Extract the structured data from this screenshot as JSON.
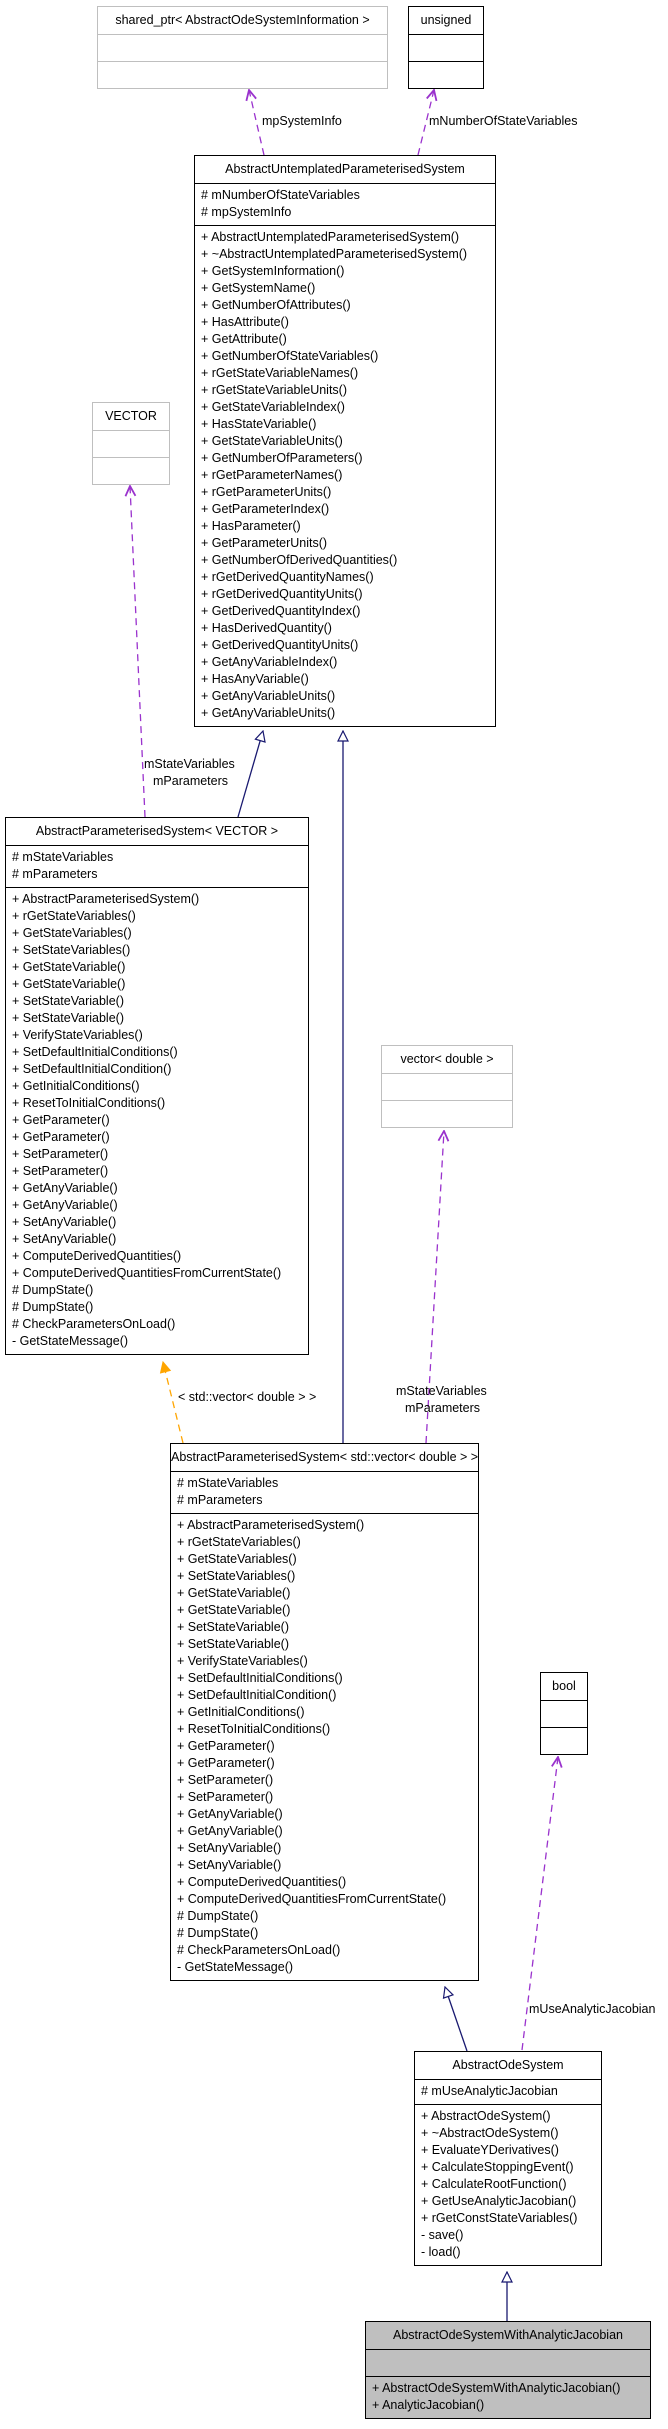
{
  "colors": {
    "inheritance": "#191970",
    "usage": "#9a32cd",
    "template": "#ffa500",
    "focus_fill": "#bfbfbf",
    "external_border": "#bfbfbf"
  },
  "classes": {
    "shared_ptr": {
      "name": "shared_ptr< AbstractOdeSystemInformation >",
      "attributes": [],
      "methods": []
    },
    "unsigned": {
      "name": "unsigned",
      "attributes": [],
      "methods": []
    },
    "vector_tpl": {
      "name": "VECTOR",
      "attributes": [],
      "methods": []
    },
    "vector_double": {
      "name": "vector< double >",
      "attributes": [],
      "methods": []
    },
    "bool": {
      "name": "bool",
      "attributes": [],
      "methods": []
    },
    "aups": {
      "name": "AbstractUntemplatedParameterisedSystem",
      "attributes": [
        "# mNumberOfStateVariables",
        "# mpSystemInfo"
      ],
      "methods": [
        "+ AbstractUntemplatedParameterisedSystem()",
        "+ ~AbstractUntemplatedParameterisedSystem()",
        "+ GetSystemInformation()",
        "+ GetSystemName()",
        "+ GetNumberOfAttributes()",
        "+ HasAttribute()",
        "+ GetAttribute()",
        "+ GetNumberOfStateVariables()",
        "+ rGetStateVariableNames()",
        "+ rGetStateVariableUnits()",
        "+ GetStateVariableIndex()",
        "+ HasStateVariable()",
        "+ GetStateVariableUnits()",
        "+ GetNumberOfParameters()",
        "+ rGetParameterNames()",
        "+ rGetParameterUnits()",
        "+ GetParameterIndex()",
        "+ HasParameter()",
        "+ GetParameterUnits()",
        "+ GetNumberOfDerivedQuantities()",
        "+ rGetDerivedQuantityNames()",
        "+ rGetDerivedQuantityUnits()",
        "+ GetDerivedQuantityIndex()",
        "+ HasDerivedQuantity()",
        "+ GetDerivedQuantityUnits()",
        "+ GetAnyVariableIndex()",
        "+ HasAnyVariable()",
        "+ GetAnyVariableUnits()",
        "+ GetAnyVariableUnits()"
      ]
    },
    "aps_vector": {
      "name": "AbstractParameterisedSystem< VECTOR >",
      "attributes": [
        "# mStateVariables",
        "# mParameters"
      ],
      "methods": [
        "+ AbstractParameterisedSystem()",
        "+ rGetStateVariables()",
        "+ GetStateVariables()",
        "+ SetStateVariables()",
        "+ GetStateVariable()",
        "+ GetStateVariable()",
        "+ SetStateVariable()",
        "+ SetStateVariable()",
        "+ VerifyStateVariables()",
        "+ SetDefaultInitialConditions()",
        "+ SetDefaultInitialCondition()",
        "+ GetInitialConditions()",
        "+ ResetToInitialConditions()",
        "+ GetParameter()",
        "+ GetParameter()",
        "+ SetParameter()",
        "+ SetParameter()",
        "+ GetAnyVariable()",
        "+ GetAnyVariable()",
        "+ SetAnyVariable()",
        "+ SetAnyVariable()",
        "+ ComputeDerivedQuantities()",
        "+ ComputeDerivedQuantitiesFromCurrentState()",
        "# DumpState()",
        "# DumpState()",
        "# CheckParametersOnLoad()",
        "- GetStateMessage()"
      ]
    },
    "aps_stdvector": {
      "name": "AbstractParameterisedSystem< std::vector< double > >",
      "attributes": [
        "# mStateVariables",
        "# mParameters"
      ],
      "methods": [
        "+ AbstractParameterisedSystem()",
        "+ rGetStateVariables()",
        "+ GetStateVariables()",
        "+ SetStateVariables()",
        "+ GetStateVariable()",
        "+ GetStateVariable()",
        "+ SetStateVariable()",
        "+ SetStateVariable()",
        "+ VerifyStateVariables()",
        "+ SetDefaultInitialConditions()",
        "+ SetDefaultInitialCondition()",
        "+ GetInitialConditions()",
        "+ ResetToInitialConditions()",
        "+ GetParameter()",
        "+ GetParameter()",
        "+ SetParameter()",
        "+ SetParameter()",
        "+ GetAnyVariable()",
        "+ GetAnyVariable()",
        "+ SetAnyVariable()",
        "+ SetAnyVariable()",
        "+ ComputeDerivedQuantities()",
        "+ ComputeDerivedQuantitiesFromCurrentState()",
        "# DumpState()",
        "# DumpState()",
        "# CheckParametersOnLoad()",
        "- GetStateMessage()"
      ]
    },
    "aos": {
      "name": "AbstractOdeSystem",
      "attributes": [
        "# mUseAnalyticJacobian"
      ],
      "methods": [
        "+ AbstractOdeSystem()",
        "+ ~AbstractOdeSystem()",
        "+ EvaluateYDerivatives()",
        "+ CalculateStoppingEvent()",
        "+ CalculateRootFunction()",
        "+ GetUseAnalyticJacobian()",
        "+ rGetConstStateVariables()",
        "- save()",
        "- load()"
      ]
    },
    "aoswaj": {
      "name": "AbstractOdeSystemWithAnalyticJacobian",
      "attributes": [],
      "methods": [
        "+ AbstractOdeSystemWithAnalyticJacobian()",
        "+ AnalyticJacobian()"
      ]
    }
  },
  "edge_labels": {
    "mpSystemInfo": "mpSystemInfo",
    "mNumberOfStateVariables": "mNumberOfStateVariables",
    "vector_members_1": "mStateVariables",
    "vector_members_2": "mParameters",
    "std_members_1": "mStateVariables",
    "std_members_2": "mParameters",
    "template_arg": "< std::vector< double > >",
    "mUseAnalyticJacobian": "mUseAnalyticJacobian"
  }
}
